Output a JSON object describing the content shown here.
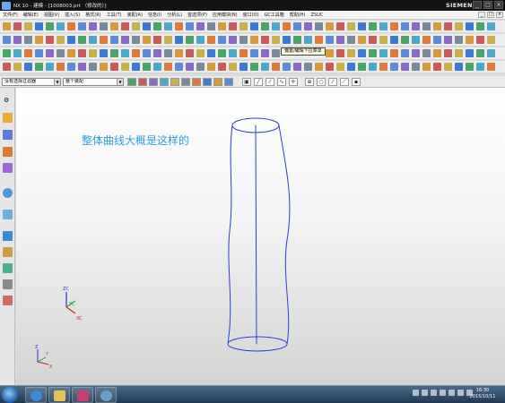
{
  "titlebar": {
    "title": "NX 10 - 建模 - [1008003.prt （修改的）]",
    "brand": "SIEMENS"
  },
  "menubar": {
    "items": [
      "文件(F)",
      "编辑(E)",
      "视图(V)",
      "插入(S)",
      "格式(R)",
      "工具(T)",
      "装配(A)",
      "信息(I)",
      "分析(L)",
      "首选项(P)",
      "应用模块(N)",
      "窗口(O)",
      "GC工具箱",
      "帮助(H)",
      "ZSUC"
    ]
  },
  "tooltip": {
    "text": "偏置/编辑下拉菜单"
  },
  "selection_bar": {
    "type_filter": "没有选择过滤器",
    "scope": "整个装配"
  },
  "viewport": {
    "annotation": "整体曲线大概是这样的",
    "triad_small": {
      "zc": "ZC",
      "yc": "YC",
      "xc": "XC"
    },
    "triad_abs": {
      "z": "Z",
      "y": "Y",
      "x": "X"
    },
    "curve_color": "#2a3fd0"
  },
  "taskbar": {
    "time": "16:30",
    "date": "2015/10/11"
  },
  "colors": {
    "annotation": "#2a9de0",
    "titlebar": "#141414"
  }
}
